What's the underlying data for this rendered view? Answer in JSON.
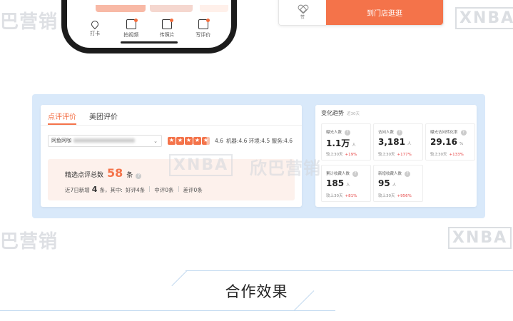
{
  "phone": {
    "tabs": [
      {
        "icon": "map-pin-icon",
        "label": "打卡"
      },
      {
        "icon": "video-icon",
        "label": "拍视频"
      },
      {
        "icon": "camera-icon",
        "label": "传照片"
      },
      {
        "icon": "edit-icon",
        "label": "写评价"
      }
    ]
  },
  "store_card": {
    "favorite_label": "赞",
    "cta_label": "到门店逛逛"
  },
  "reviews": {
    "tabs": [
      {
        "label": "点评评价",
        "active": true
      },
      {
        "label": "美团评价",
        "active": false
      }
    ],
    "shop_prefix": "网鱼网咖",
    "rating": 4.6,
    "rating_text": "4.6",
    "sub_scores": "机器:4.6  环境:4.5  服务:4.6",
    "summary": {
      "label": "精选点评总数",
      "count": "58",
      "unit": "条",
      "recent_label": "近7日新增",
      "recent_count": "4",
      "recent_unit": "条，其中:",
      "good": "好评4条",
      "medium": "中评0条",
      "bad": "差评0条"
    }
  },
  "trends": {
    "title": "变化趋势",
    "subtitle": "近30天",
    "metrics": [
      {
        "label": "曝光人数",
        "value": "1.1万",
        "unit": "人",
        "compare": "较上30天",
        "change": "+19%"
      },
      {
        "label": "访问人数",
        "value": "3,181",
        "unit": "人",
        "compare": "较上30天",
        "change": "+177%"
      },
      {
        "label": "曝光访问转化率",
        "value": "29.16",
        "unit": "%",
        "compare": "较上30天",
        "change": "+133%"
      },
      {
        "label": "累计收藏人数",
        "value": "185",
        "unit": "人",
        "compare": "较上30天",
        "change": "+81%"
      },
      {
        "label": "新增收藏人数",
        "value": "95",
        "unit": "人",
        "compare": "较上30天",
        "change": "+956%"
      }
    ]
  },
  "watermark": {
    "logo": "XNBA",
    "brand": "欣巴营销",
    "brand_short": "巴营销"
  },
  "section_title": "合作效果",
  "colors": {
    "accent": "#f4734a",
    "panel_bg": "#d9e9fa",
    "increase": "#e64545"
  }
}
